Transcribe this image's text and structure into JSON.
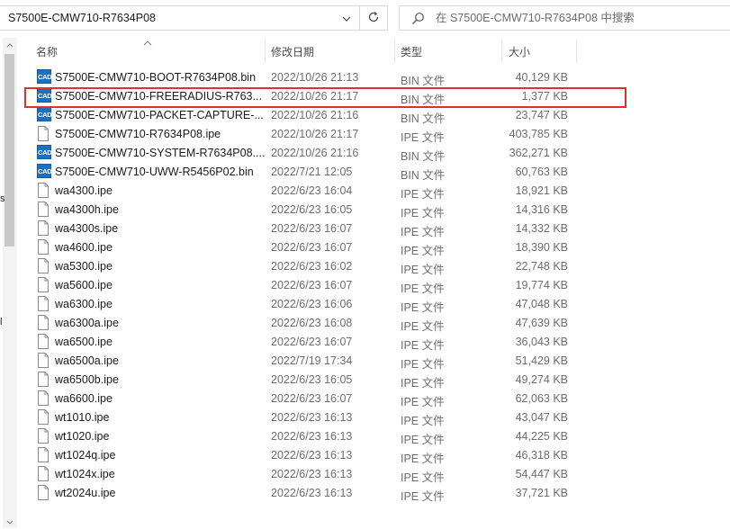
{
  "address": {
    "path": "S7500E-CMW710-R7634P08"
  },
  "search": {
    "placeholder": "在 S7500E-CMW710-R7634P08 中搜索"
  },
  "nav_fragments": [
    "s",
    "l"
  ],
  "columns": {
    "name": "名称",
    "date": "修改日期",
    "type": "类型",
    "size": "大小"
  },
  "files": [
    {
      "name": "S7500E-CMW710-BOOT-R7634P08.bin",
      "date": "2022/10/26 21:13",
      "type": "BIN 文件",
      "size": "40,129 KB",
      "icon": "cad-icon"
    },
    {
      "name": "S7500E-CMW710-FREERADIUS-R763...",
      "date": "2022/10/26 21:17",
      "type": "BIN 文件",
      "size": "1,377 KB",
      "icon": "cad-icon"
    },
    {
      "name": "S7500E-CMW710-PACKET-CAPTURE-...",
      "date": "2022/10/26 21:16",
      "type": "BIN 文件",
      "size": "23,747 KB",
      "icon": "cad-icon"
    },
    {
      "name": "S7500E-CMW710-R7634P08.ipe",
      "date": "2022/10/26 21:17",
      "type": "IPE 文件",
      "size": "403,785 KB",
      "icon": "file-icon"
    },
    {
      "name": "S7500E-CMW710-SYSTEM-R7634P08....",
      "date": "2022/10/26 21:16",
      "type": "BIN 文件",
      "size": "362,271 KB",
      "icon": "cad-icon"
    },
    {
      "name": "S7500E-CMW710-UWW-R5456P02.bin",
      "date": "2022/7/21 12:05",
      "type": "BIN 文件",
      "size": "60,763 KB",
      "icon": "cad-icon"
    },
    {
      "name": "wa4300.ipe",
      "date": "2022/6/23 16:04",
      "type": "IPE 文件",
      "size": "18,921 KB",
      "icon": "file-icon"
    },
    {
      "name": "wa4300h.ipe",
      "date": "2022/6/23 16:05",
      "type": "IPE 文件",
      "size": "14,316 KB",
      "icon": "file-icon"
    },
    {
      "name": "wa4300s.ipe",
      "date": "2022/6/23 16:07",
      "type": "IPE 文件",
      "size": "14,332 KB",
      "icon": "file-icon"
    },
    {
      "name": "wa4600.ipe",
      "date": "2022/6/23 16:07",
      "type": "IPE 文件",
      "size": "18,390 KB",
      "icon": "file-icon"
    },
    {
      "name": "wa5300.ipe",
      "date": "2022/6/23 16:02",
      "type": "IPE 文件",
      "size": "22,748 KB",
      "icon": "file-icon"
    },
    {
      "name": "wa5600.ipe",
      "date": "2022/6/23 16:07",
      "type": "IPE 文件",
      "size": "19,774 KB",
      "icon": "file-icon"
    },
    {
      "name": "wa6300.ipe",
      "date": "2022/6/23 16:06",
      "type": "IPE 文件",
      "size": "47,048 KB",
      "icon": "file-icon"
    },
    {
      "name": "wa6300a.ipe",
      "date": "2022/6/23 16:08",
      "type": "IPE 文件",
      "size": "47,639 KB",
      "icon": "file-icon"
    },
    {
      "name": "wa6500.ipe",
      "date": "2022/6/23 16:07",
      "type": "IPE 文件",
      "size": "36,043 KB",
      "icon": "file-icon"
    },
    {
      "name": "wa6500a.ipe",
      "date": "2022/7/19 17:34",
      "type": "IPE 文件",
      "size": "51,429 KB",
      "icon": "file-icon"
    },
    {
      "name": "wa6500b.ipe",
      "date": "2022/6/23 16:05",
      "type": "IPE 文件",
      "size": "49,274 KB",
      "icon": "file-icon"
    },
    {
      "name": "wa6600.ipe",
      "date": "2022/6/23 16:07",
      "type": "IPE 文件",
      "size": "62,063 KB",
      "icon": "file-icon"
    },
    {
      "name": "wt1010.ipe",
      "date": "2022/6/23 16:13",
      "type": "IPE 文件",
      "size": "43,047 KB",
      "icon": "file-icon"
    },
    {
      "name": "wt1020.ipe",
      "date": "2022/6/23 16:13",
      "type": "IPE 文件",
      "size": "44,225 KB",
      "icon": "file-icon"
    },
    {
      "name": "wt1024q.ipe",
      "date": "2022/6/23 16:13",
      "type": "IPE 文件",
      "size": "46,318 KB",
      "icon": "file-icon"
    },
    {
      "name": "wt1024x.ipe",
      "date": "2022/6/23 16:13",
      "type": "IPE 文件",
      "size": "54,447 KB",
      "icon": "file-icon"
    },
    {
      "name": "wt2024u.ipe",
      "date": "2022/6/23 16:13",
      "type": "IPE 文件",
      "size": "37,721 KB",
      "icon": "file-icon"
    }
  ],
  "highlighted_row": 1,
  "colors": {
    "highlight": "#e0302e",
    "cad_icon": "#1f6fbf"
  }
}
